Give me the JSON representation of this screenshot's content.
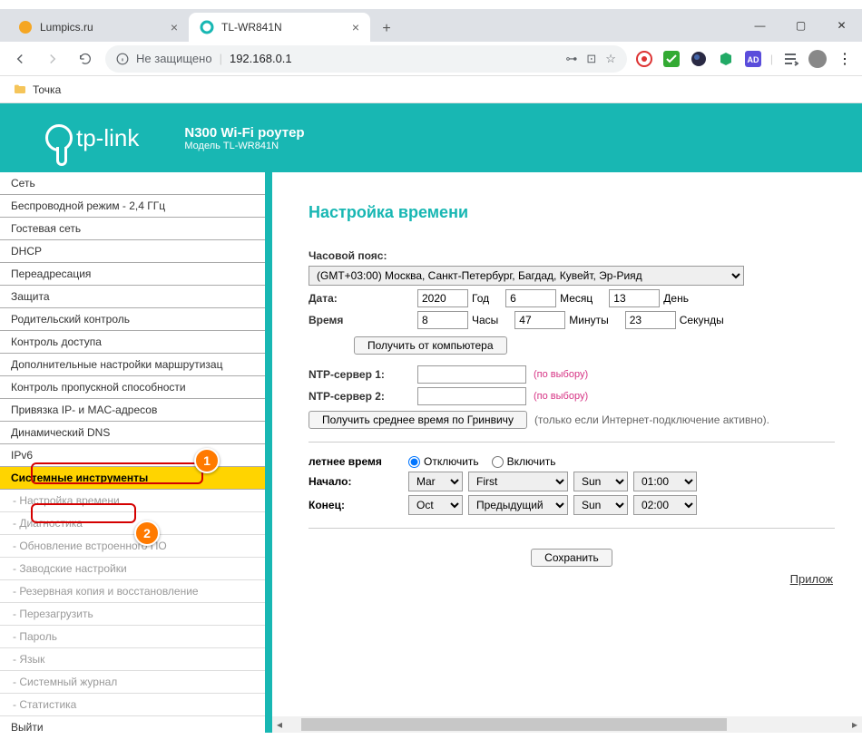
{
  "tabs": {
    "inactive": "Lumpics.ru",
    "active": "TL-WR841N"
  },
  "addr": {
    "insecure": "Не защищено",
    "url": "192.168.0.1"
  },
  "bookmarks": {
    "folder": "Точка"
  },
  "banner": {
    "brand": "tp-link",
    "title": "N300 Wi-Fi роутер",
    "model": "Модель TL-WR841N"
  },
  "sidebar": {
    "items": [
      "Сеть",
      "Беспроводной режим - 2,4 ГГц",
      "Гостевая сеть",
      "DHCP",
      "Переадресация",
      "Защита",
      "Родительский контроль",
      "Контроль доступа",
      "Дополнительные настройки маршрутизац",
      "Контроль пропускной способности",
      "Привязка IP- и MAC-адресов",
      "Динамический DNS",
      "IPv6"
    ],
    "active": "Системные инструменты",
    "subs": [
      "- Настройка времени",
      "- Диагностика",
      "- Обновление встроенного ПО",
      "- Заводские настройки",
      "- Резервная копия и восстановление",
      "- Перезагрузить",
      "- Пароль",
      "- Язык",
      "- Системный журнал",
      "- Статистика"
    ],
    "exit": "Выйти"
  },
  "main": {
    "title": "Настройка времени",
    "tz_label": "Часовой пояс:",
    "tz_value": "(GMT+03:00) Москва, Санкт-Петербург, Багдад, Кувейт, Эр-Рияд",
    "date_label": "Дата:",
    "year": "2020",
    "year_u": "Год",
    "month": "6",
    "month_u": "Месяц",
    "day": "13",
    "day_u": "День",
    "time_label": "Время",
    "hour": "8",
    "hour_u": "Часы",
    "min": "47",
    "min_u": "Минуты",
    "sec": "23",
    "sec_u": "Секунды",
    "btn_pc": "Получить от компьютера",
    "ntp1": "NTP-сервер 1:",
    "ntp2": "NTP-сервер 2:",
    "optional": "(по выбору)",
    "btn_gmt": "Получить среднее время по Гринвичу",
    "gmt_note": "(только если Интернет-подключение активно).",
    "dst_label": "летнее время",
    "dst_off": "Отключить",
    "dst_on": "Включить",
    "start_label": "Начало:",
    "end_label": "Конец:",
    "start_mon": "Mar",
    "start_week": "First",
    "start_day": "Sun",
    "start_time": "01:00",
    "end_mon": "Oct",
    "end_week": "Предыдущий",
    "end_day": "Sun",
    "end_time": "02:00",
    "save": "Сохранить",
    "app": "Прилож"
  }
}
